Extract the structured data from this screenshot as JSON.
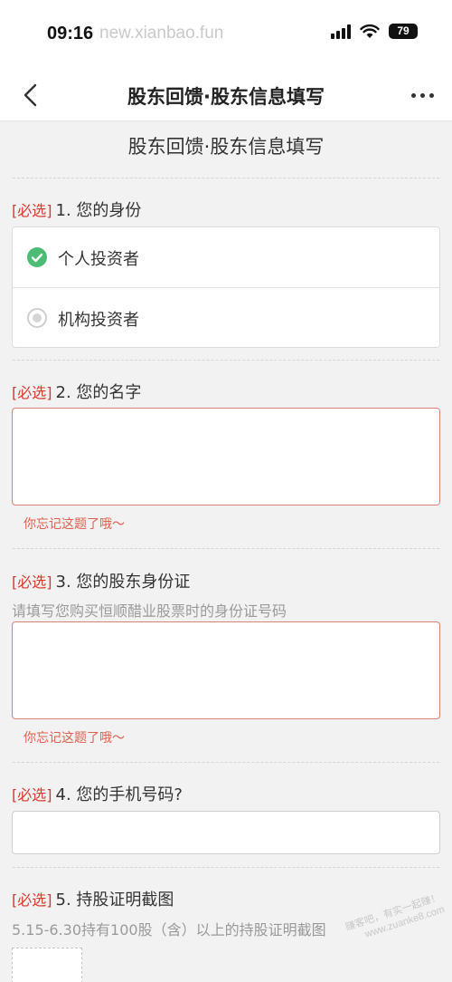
{
  "status_bar": {
    "time": "09:16",
    "watermark": "new.xianbao.fun",
    "battery": "79"
  },
  "nav": {
    "title": "股东回馈·股东信息填写"
  },
  "form": {
    "title": "股东回馈·股东信息填写",
    "required_tag": "[必选]",
    "q1": {
      "label": "1. 您的身份",
      "options": [
        {
          "label": "个人投资者",
          "selected": true
        },
        {
          "label": "机构投资者",
          "selected": false
        }
      ]
    },
    "q2": {
      "label": "2. 您的名字",
      "value": "",
      "error": "你忘记这题了哦～"
    },
    "q3": {
      "label": "3. 您的股东身份证",
      "hint": "请填写您购买恒顺醋业股票时的身份证号码",
      "value": "",
      "error": "你忘记这题了哦～"
    },
    "q4": {
      "label": "4. 您的手机号码?",
      "value": ""
    },
    "q5": {
      "label": "5. 持股证明截图",
      "hint": "5.15-6.30持有100股（含）以上的持股证明截图"
    }
  },
  "overlay_watermark": {
    "line1": "赚客吧，有实一起赚！",
    "line2": "www.zuanke8.com"
  },
  "colors": {
    "required": "#d9372b",
    "error": "#e0614f",
    "check": "#4cbc74"
  }
}
